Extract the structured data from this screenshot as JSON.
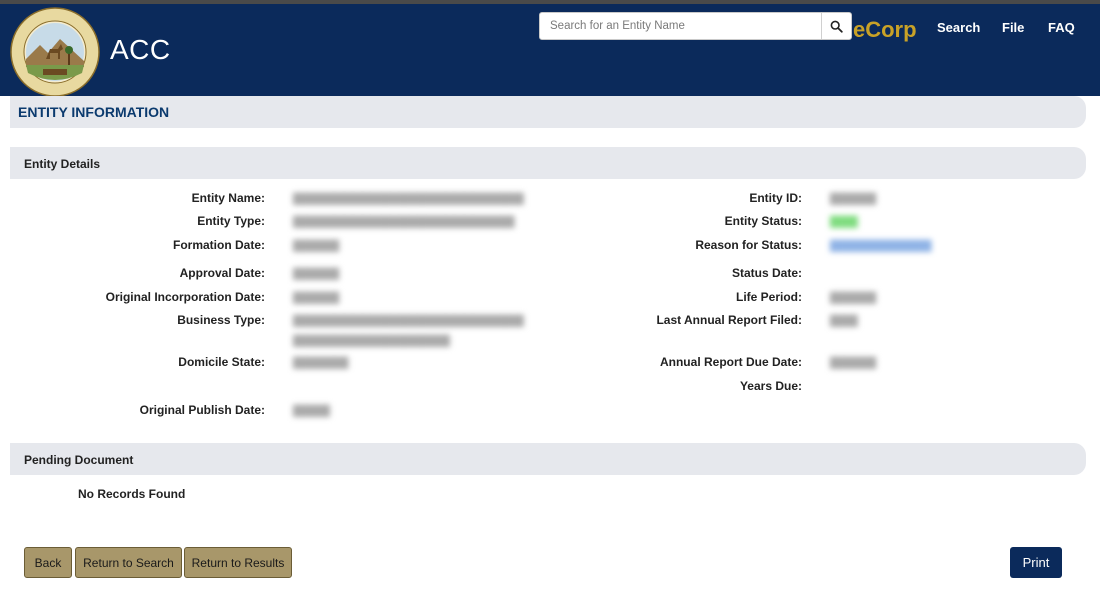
{
  "header": {
    "brand": "ACC",
    "seal_text_top": "SEAL OF THE ARIZONA CORPORATION COMMISSION",
    "seal_motto": "DITAT DEUS",
    "seal_year": "• 1912 •",
    "search_placeholder": "Search for an Entity Name",
    "ecorp": "eCorp",
    "nav": [
      "Search",
      "File",
      "FAQ"
    ],
    "colors": {
      "navy": "#0b2a5b",
      "gold": "#c9a227"
    }
  },
  "page_title": "ENTITY INFORMATION",
  "entity_details": {
    "section_title": "Entity Details",
    "left_labels": {
      "entity_name": "Entity Name:",
      "entity_type": "Entity Type:",
      "formation_date": "Formation Date:",
      "approval_date": "Approval Date:",
      "original_incorporation_date": "Original Incorporation Date:",
      "business_type": "Business Type:",
      "domicile_state": "Domicile State:",
      "original_publish_date": "Original Publish Date:"
    },
    "right_labels": {
      "entity_id": "Entity ID:",
      "entity_status": "Entity Status:",
      "reason_for_status": "Reason for Status:",
      "status_date": "Status Date:",
      "life_period": "Life Period:",
      "last_annual_report_filed": "Last Annual Report Filed:",
      "annual_report_due_date": "Annual Report Due Date:",
      "years_due": "Years Due:"
    }
  },
  "pending_document": {
    "section_title": "Pending Document",
    "empty_text": "No Records Found"
  },
  "buttons": {
    "back": "Back",
    "return_to_search": "Return to Search",
    "return_to_results": "Return to Results",
    "print": "Print"
  }
}
